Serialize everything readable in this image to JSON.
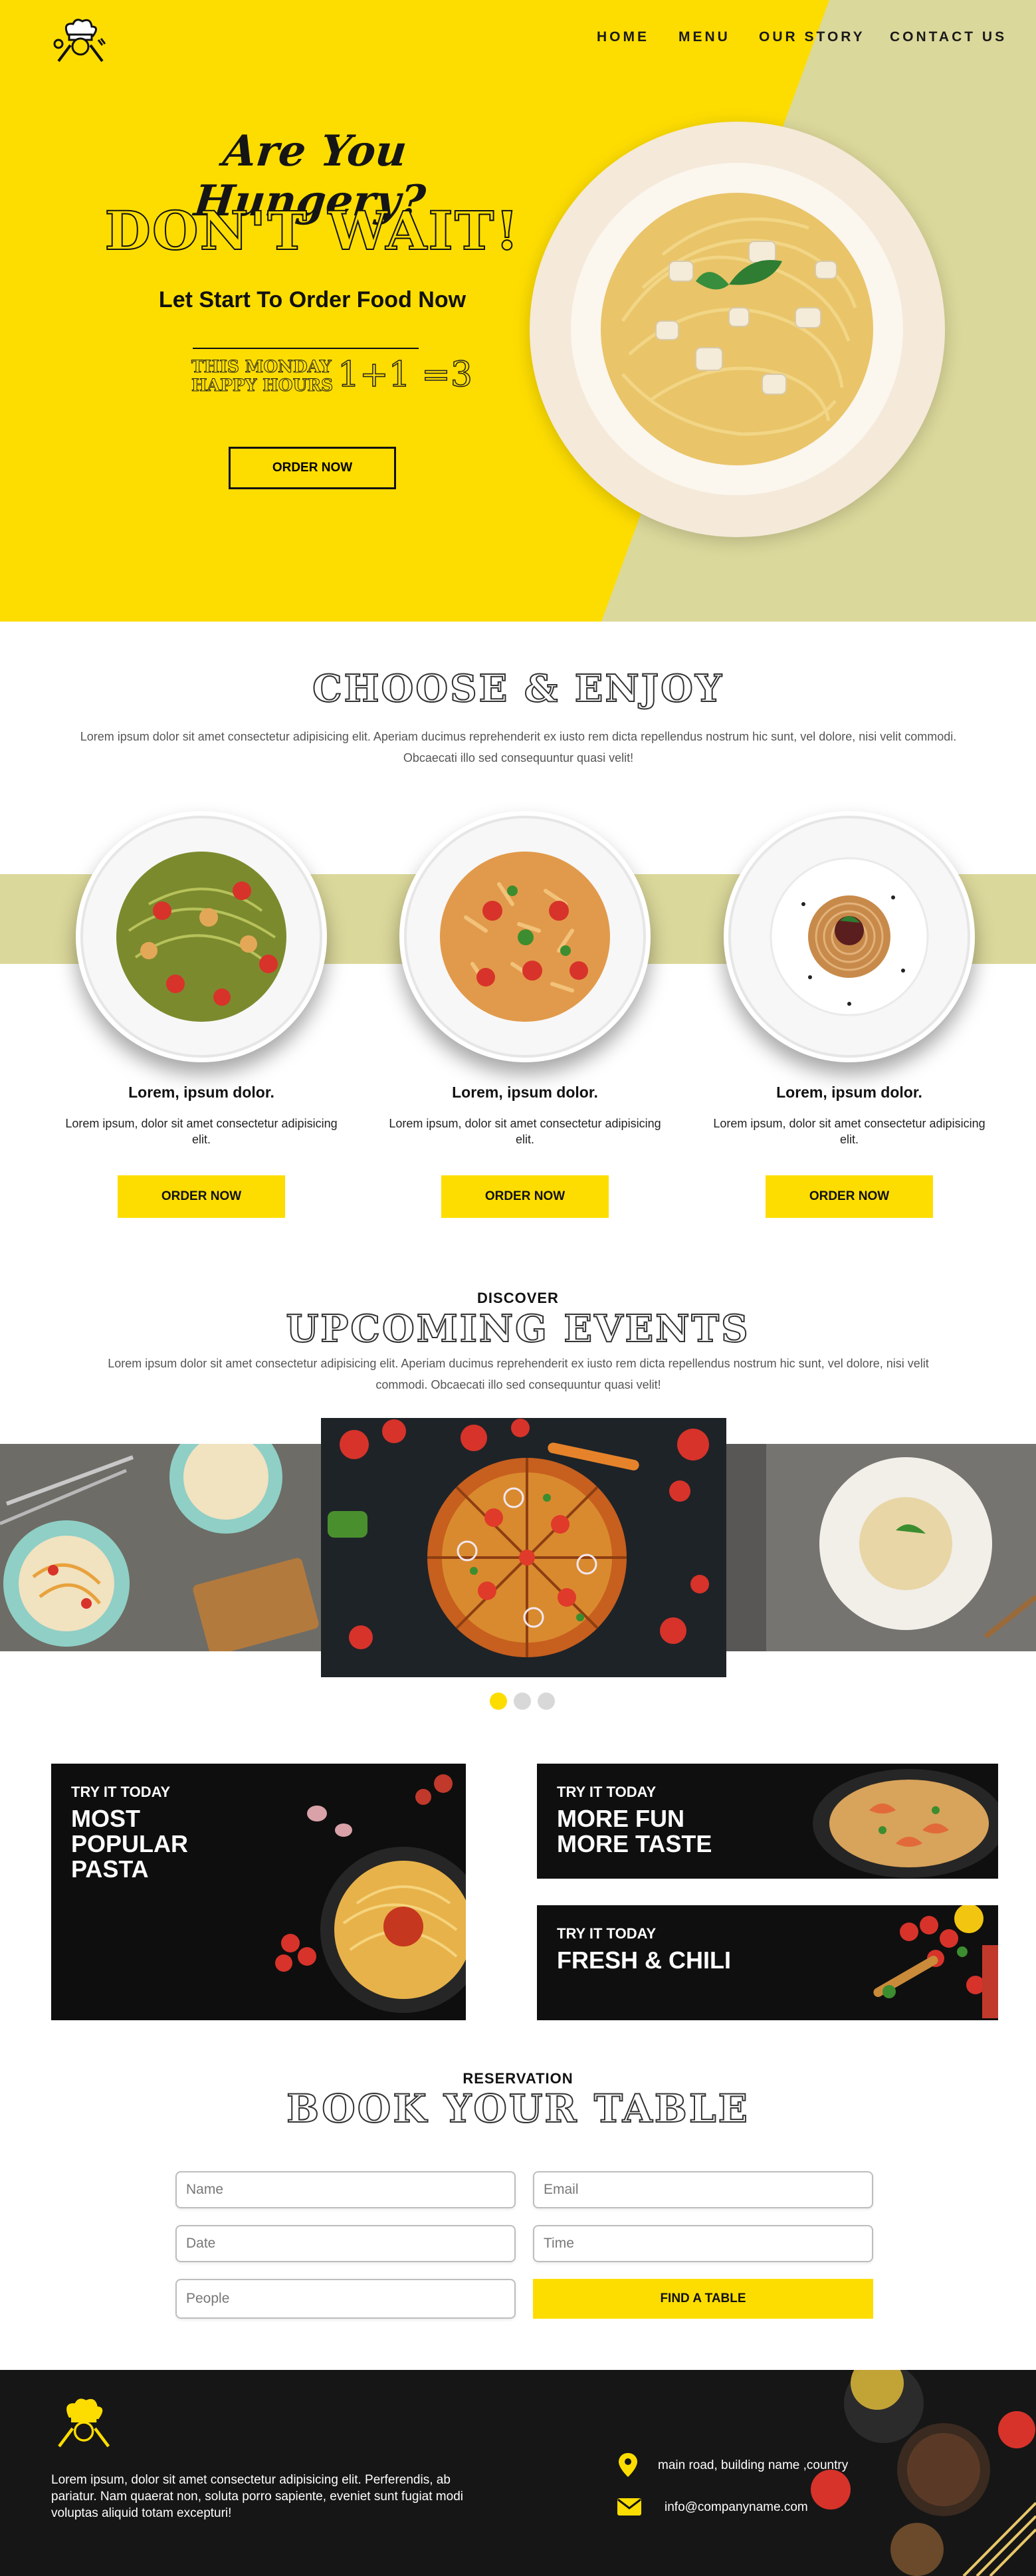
{
  "colors": {
    "accent": "#FDDD00",
    "olive": "#DBD89B",
    "dark": "#0B0B0B"
  },
  "nav": {
    "items": [
      "HOME",
      "MENU",
      "OUR STORY",
      "CONTACT US"
    ]
  },
  "hero": {
    "tagline": "Are You Hungery?",
    "headline": "DON'T WAIT!",
    "subheadline": "Let Start To Order Food Now",
    "promo_line1": "THIS MONDAY",
    "promo_line2": "HAPPY HOURS",
    "promo_offer": "1+1 =3",
    "cta": "ORDER NOW"
  },
  "choose": {
    "title": "CHOOSE & ENJOY",
    "text": "Lorem ipsum dolor sit amet consectetur adipisicing elit. Aperiam ducimus reprehenderit ex iusto rem dicta repellendus nostrum hic sunt, vel dolore, nisi velit commodi. Obcaecati illo sed consequuntur quasi velit!",
    "dishes": [
      {
        "title": "Lorem, ipsum dolor.",
        "desc": "Lorem ipsum, dolor sit amet consectetur adipisicing elit.",
        "cta": "ORDER NOW"
      },
      {
        "title": "Lorem, ipsum dolor.",
        "desc": "Lorem ipsum, dolor sit amet consectetur adipisicing elit.",
        "cta": "ORDER NOW"
      },
      {
        "title": "Lorem, ipsum dolor.",
        "desc": "Lorem ipsum, dolor sit amet consectetur adipisicing elit.",
        "cta": "ORDER NOW"
      }
    ]
  },
  "events": {
    "kicker": "DISCOVER",
    "title": "UPCOMING EVENTS",
    "text": "Lorem ipsum dolor sit amet consectetur adipisicing elit. Aperiam ducimus reprehenderit ex iusto rem dicta repellendus nostrum hic sunt, vel dolore, nisi velit commodi. Obcaecati illo sed consequuntur quasi velit!",
    "active_slide": 1,
    "slide_count": 3
  },
  "promos": [
    {
      "kicker": "TRY IT TODAY",
      "title": "MOST\nPOPULAR\nPASTA"
    },
    {
      "kicker": "TRY IT TODAY",
      "title": "MORE FUN\nMORE TASTE"
    },
    {
      "kicker": "TRY IT TODAY",
      "title": "FRESH & CHILI"
    }
  ],
  "reservation": {
    "kicker": "RESERVATION",
    "title": "BOOK YOUR TABLE",
    "placeholders": {
      "name": "Name",
      "email": "Email",
      "date": "Date",
      "time": "Time",
      "people": "People"
    },
    "submit": "FIND A TABLE"
  },
  "footer": {
    "about": "Lorem ipsum, dolor sit amet consectetur adipisicing elit. Perferendis, ab pariatur. Nam quaerat non, soluta porro sapiente, eveniet sunt fugiat modi voluptas aliquid totam excepturi!",
    "address": "main road, building name ,country",
    "email": "info@companyname.com"
  }
}
